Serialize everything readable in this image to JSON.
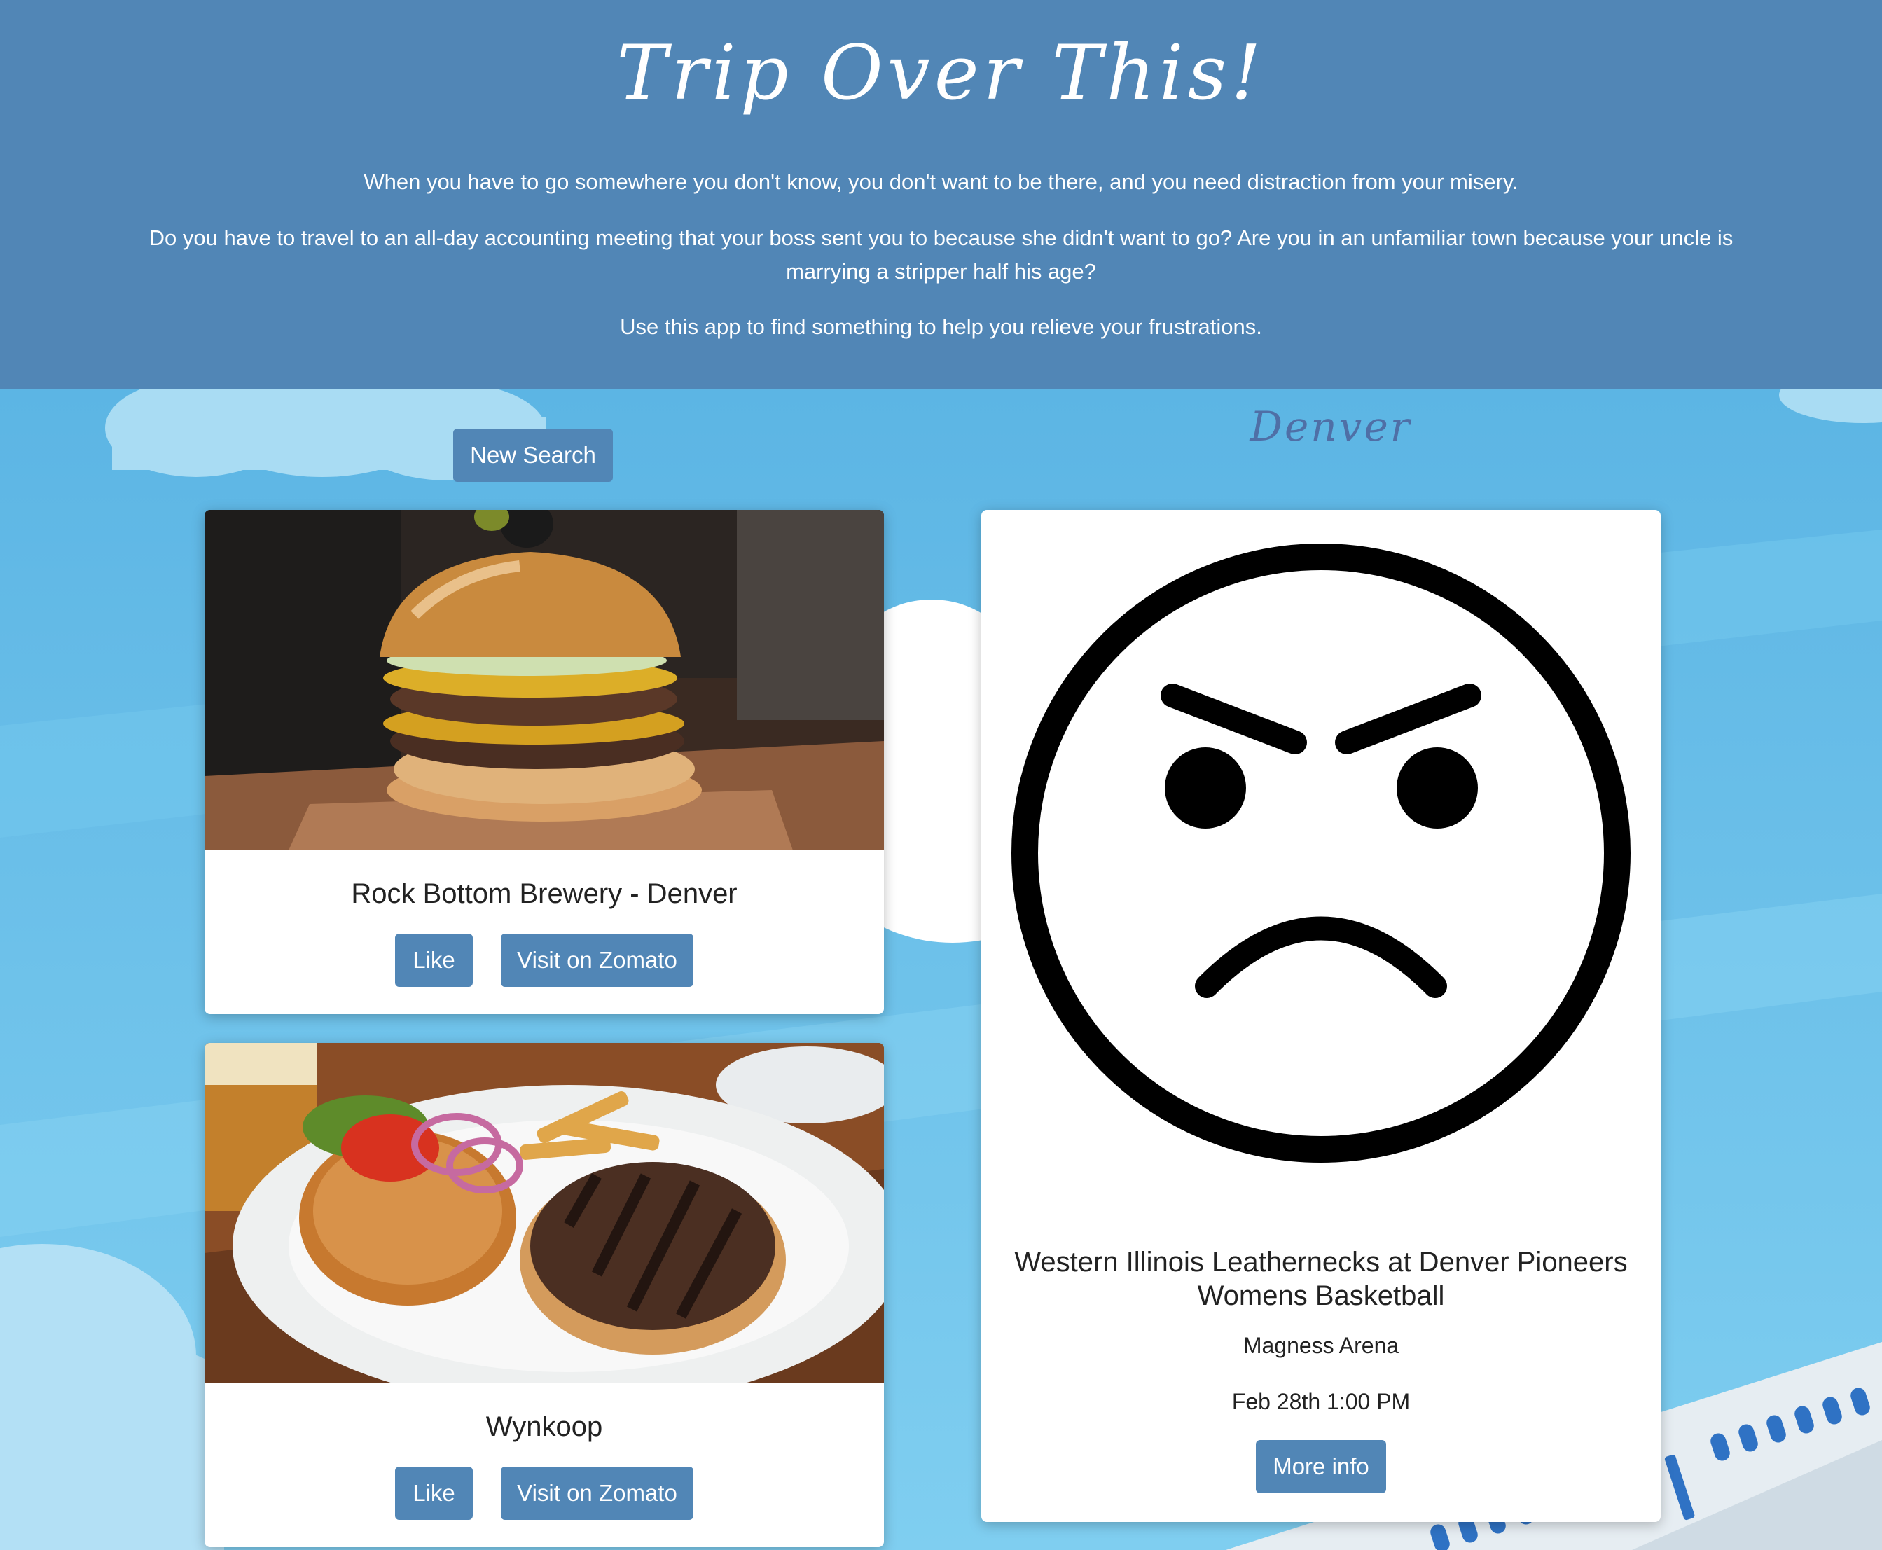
{
  "header": {
    "title": "Trip Over This!",
    "intro": "When you have to go somewhere you don't know, you don't want to be there, and you need distraction from your misery.",
    "question": "Do you have to travel to an all-day accounting meeting that your boss sent you to because she didn't want to go? Are you in an unfamiliar town because your uncle is marrying a stripper half his age?",
    "call_to_action": "Use this app to find something to help you relieve your frustrations."
  },
  "controls": {
    "new_search_label": "New Search",
    "city": "Denver"
  },
  "restaurants": [
    {
      "name": "Rock Bottom Brewery - Denver",
      "like_label": "Like",
      "visit_label": "Visit on Zomato"
    },
    {
      "name": "Wynkoop",
      "like_label": "Like",
      "visit_label": "Visit on Zomato"
    }
  ],
  "event": {
    "title": "Western Illinois Leathernecks at Denver Pioneers Womens Basketball",
    "venue": "Magness Arena",
    "datetime": "Feb 28th 1:00 PM",
    "more_info_label": "More info",
    "image_icon": "angry-face-icon"
  },
  "colors": {
    "header_bg": "#5186b6",
    "button_bg": "#5186b6",
    "sky": "#6cc0e8"
  }
}
